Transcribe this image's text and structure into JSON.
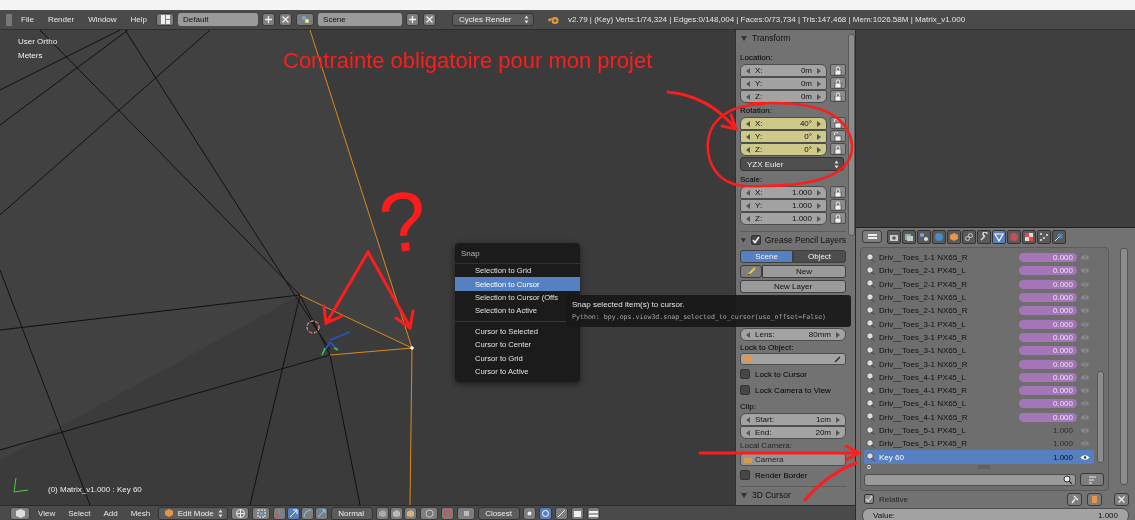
{
  "top_bar": {
    "menus": [
      "File",
      "Render",
      "Window",
      "Help"
    ],
    "screen_layout": "Default",
    "scene": "Scene",
    "render_engine": "Cycles Render",
    "stats": "v2.79 | (Key) Verts:1/74,324 | Edges:0/148,004 | Faces:0/73,734 | Tris:147,468 | Mem:1026.58M | Matrix_v1.000"
  },
  "viewport": {
    "view": "User Ortho",
    "units": "Meters",
    "object_info": "(0) Matrix_v1.000 : Key 60"
  },
  "snap_menu": {
    "title": "Snap",
    "groups": [
      {
        "items": [
          {
            "label": "Selection to Grid",
            "selected": false
          },
          {
            "label": "Selection to Cursor",
            "selected": true
          },
          {
            "label": "Selection to Cursor (Offs",
            "selected": false
          },
          {
            "label": "Selection to Active",
            "selected": false
          }
        ]
      },
      {
        "items": [
          {
            "label": "Cursor to Selected",
            "selected": false
          },
          {
            "label": "Cursor to Center",
            "selected": false
          },
          {
            "label": "Cursor to Grid",
            "selected": false
          },
          {
            "label": "Cursor to Active",
            "selected": false
          }
        ]
      }
    ]
  },
  "tooltip": {
    "description": "Snap selected item(s) to cursor.",
    "python": "Python: bpy.ops.view3d.snap_selected_to_cursor(use_offset=False)"
  },
  "annotation": {
    "text": "Contrainte obligatoire pour mon projet",
    "mark": "?"
  },
  "n_panel": {
    "transform": {
      "title": "Transform",
      "location": {
        "label": "Location:",
        "fields": [
          {
            "axis": "X:",
            "value": "0m",
            "keyed": false,
            "locked": true
          },
          {
            "axis": "Y:",
            "value": "0m",
            "keyed": false,
            "locked": true
          },
          {
            "axis": "Z:",
            "value": "0m",
            "keyed": false,
            "locked": true
          }
        ]
      },
      "rotation": {
        "label": "Rotation:",
        "fields": [
          {
            "axis": "X:",
            "value": "40°",
            "keyed": true,
            "locked": false
          },
          {
            "axis": "Y:",
            "value": "0°",
            "keyed": true,
            "locked": false
          },
          {
            "axis": "Z:",
            "value": "0°",
            "keyed": true,
            "locked": true
          }
        ],
        "mode": "YZX Euler"
      },
      "scale": {
        "label": "Scale:",
        "fields": [
          {
            "axis": "X:",
            "value": "1.000",
            "keyed": false,
            "locked": true
          },
          {
            "axis": "Y:",
            "value": "1.000",
            "keyed": false,
            "locked": true
          },
          {
            "axis": "Z:",
            "value": "1.000",
            "keyed": false,
            "locked": true
          }
        ]
      }
    },
    "grease_pencil": {
      "title": "Grease Pencil Layers",
      "enabled": true,
      "tabs": [
        {
          "label": "Scene",
          "selected": true
        },
        {
          "label": "Object",
          "selected": false
        }
      ],
      "new_button": "New",
      "new_layer_button": "New Layer"
    },
    "view": {
      "lens": {
        "axis": "Lens:",
        "value": "80mm"
      },
      "lock_object_label": "Lock to Object:",
      "lock_options": [
        {
          "label": "Lock to Cursor",
          "checked": false
        },
        {
          "label": "Lock Camera to View",
          "checked": false
        }
      ],
      "clip_label": "Clip:",
      "clip": [
        {
          "axis": "Start:",
          "value": "1cm"
        },
        {
          "axis": "End:",
          "value": "20m"
        }
      ],
      "local_camera": {
        "label": "Local Camera:",
        "camera": "Camera",
        "disabled": true
      },
      "render_border": {
        "label": "Render Border",
        "checked": false
      }
    },
    "cursor_title": "3D Cursor"
  },
  "bottom_bar": {
    "menus": [
      "View",
      "Select",
      "Add",
      "Mesh"
    ],
    "mode": "Edit Mode",
    "orientation": "Normal",
    "snap_target": "Closest"
  },
  "properties": {
    "tabs": [
      {
        "selected": false
      },
      {
        "selected": false
      },
      {
        "selected": false
      },
      {
        "selected": false
      },
      {
        "selected": false
      },
      {
        "selected": false
      },
      {
        "selected": false
      },
      {
        "selected": true
      },
      {
        "selected": false
      },
      {
        "selected": false
      },
      {
        "selected": false
      },
      {
        "selected": false
      }
    ],
    "shape_keys": [
      {
        "name": "Driv__Toes_1-1 NX65_R",
        "value": "0.000",
        "driven": true,
        "selected": false
      },
      {
        "name": "Driv__Toes_2-1 PX45_L",
        "value": "0.000",
        "driven": true,
        "selected": false
      },
      {
        "name": "Driv__Toes_2-1 PX45_R",
        "value": "0.000",
        "driven": true,
        "selected": false
      },
      {
        "name": "Driv__Toes_2-1 NX65_L",
        "value": "0.000",
        "driven": true,
        "selected": false
      },
      {
        "name": "Driv__Toes_2-1 NX65_R",
        "value": "0.000",
        "driven": true,
        "selected": false
      },
      {
        "name": "Driv__Toes_3-1 PX45_L",
        "value": "0.000",
        "driven": true,
        "selected": false
      },
      {
        "name": "Driv__Toes_3-1 PX45_R",
        "value": "0.000",
        "driven": true,
        "selected": false
      },
      {
        "name": "Driv__Toes_3-1 NX65_L",
        "value": "0.000",
        "driven": true,
        "selected": false
      },
      {
        "name": "Driv__Toes_3-1 NX65_R",
        "value": "0.000",
        "driven": true,
        "selected": false
      },
      {
        "name": "Driv__Toes_4-1 PX45_L",
        "value": "0.000",
        "driven": true,
        "selected": false
      },
      {
        "name": "Driv__Toes_4-1 PX45_R",
        "value": "0.000",
        "driven": true,
        "selected": false
      },
      {
        "name": "Driv__Toes_4-1 NX65_L",
        "value": "0.000",
        "driven": true,
        "selected": false
      },
      {
        "name": "Driv__Toes_4-1 NX65_R",
        "value": "0.000",
        "driven": true,
        "selected": false
      },
      {
        "name": "Driv__Toes_5-1 PX45_L",
        "value": "1.000",
        "driven": false,
        "selected": false
      },
      {
        "name": "Driv__Toes_5-1 PX45_R",
        "value": "1.000",
        "driven": false,
        "selected": false
      },
      {
        "name": "Key 60",
        "value": "1.000",
        "driven": false,
        "selected": true
      }
    ],
    "relative": {
      "label": "Relative",
      "checked": true,
      "disabled": true
    },
    "value": {
      "label": "Value:",
      "value": "1.000"
    }
  }
}
